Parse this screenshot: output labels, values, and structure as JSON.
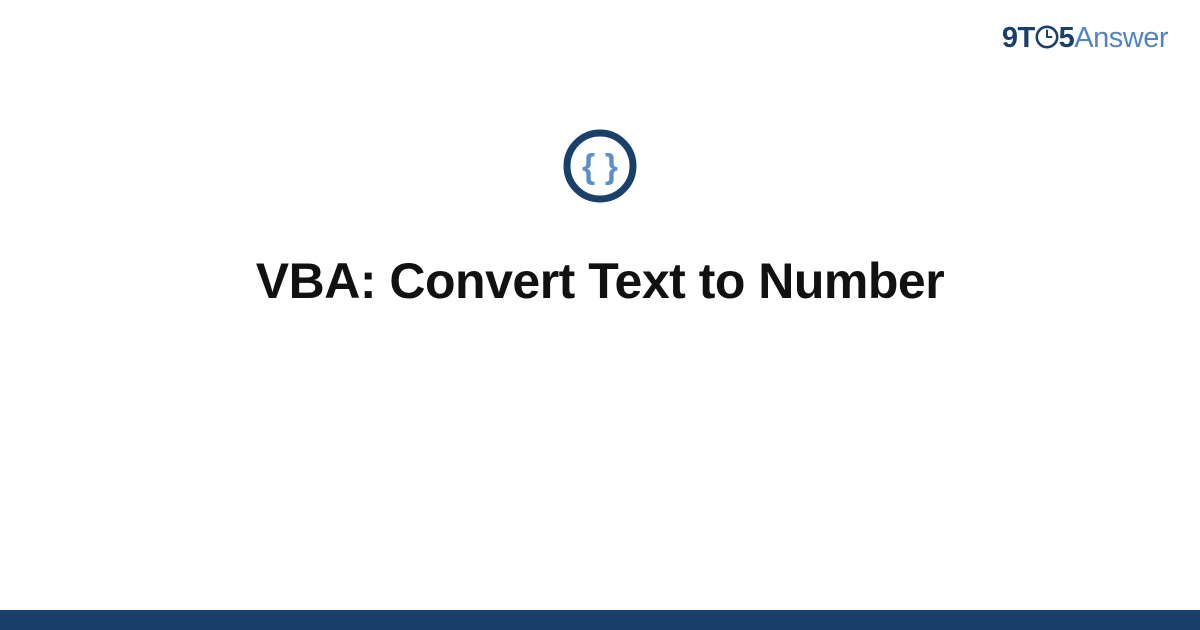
{
  "brand": {
    "prefix_9t": "9T",
    "digit_5": "5",
    "answer": "Answer"
  },
  "title": "VBA: Convert Text to Number",
  "colors": {
    "brand_dark": "#18406b",
    "brand_light": "#5184c4",
    "text": "#111111"
  }
}
